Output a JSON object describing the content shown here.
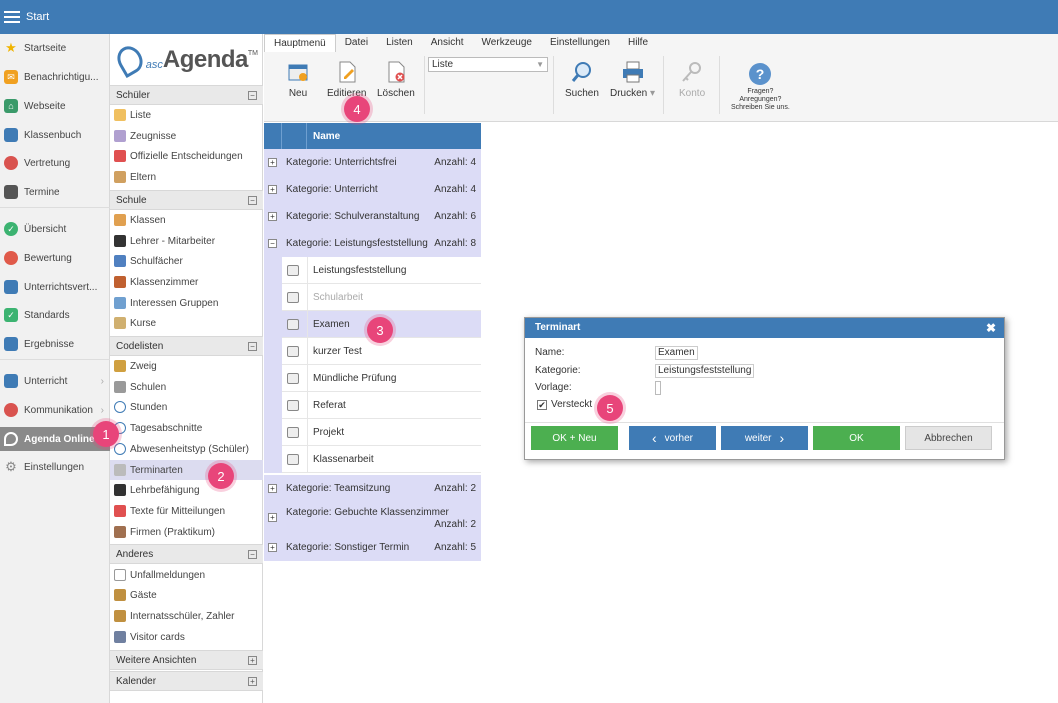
{
  "topbar": {
    "title": "Start"
  },
  "leftnav": {
    "items": [
      {
        "label": "Startseite",
        "icon": "star-icon",
        "color": "#f0b400"
      },
      {
        "label": "Benachrichtigu...",
        "icon": "envelope-icon",
        "color": "#f0a020"
      },
      {
        "label": "Webseite",
        "icon": "home-icon",
        "color": "#3a9a6a"
      },
      {
        "label": "Klassenbuch",
        "icon": "book-icon",
        "color": "#3f7bb5"
      },
      {
        "label": "Vertretung",
        "icon": "person-icon",
        "color": "#d9534f"
      },
      {
        "label": "Termine",
        "icon": "calendar-icon",
        "color": "#555555"
      },
      {
        "label": "Übersicht",
        "icon": "check-circle-icon",
        "color": "#3cb371"
      },
      {
        "label": "Bewertung",
        "icon": "chart-circle-icon",
        "color": "#e05a4a"
      },
      {
        "label": "Unterrichtsvert...",
        "icon": "table-icon",
        "color": "#3f7bb5"
      },
      {
        "label": "Standards",
        "icon": "shield-check-icon",
        "color": "#3cb371"
      },
      {
        "label": "Ergebnisse",
        "icon": "bar-chart-icon",
        "color": "#3f7bb5"
      },
      {
        "label": "Unterricht",
        "icon": "monitor-icon",
        "color": "#3f7bb5"
      },
      {
        "label": "Kommunikation",
        "icon": "chat-icon",
        "color": "#d9534f"
      },
      {
        "label": "Agenda Online",
        "icon": "agenda-icon",
        "color": "#ffffff"
      },
      {
        "label": "Einstellungen",
        "icon": "gear-icon",
        "color": "#888888"
      }
    ]
  },
  "logo": {
    "prefix": "asc",
    "name": "Agenda",
    "tm": "TM"
  },
  "sections": {
    "schueler": {
      "title": "Schüler",
      "items": [
        "Liste",
        "Zeugnisse",
        "Offizielle Entscheidungen",
        "Eltern"
      ]
    },
    "schule": {
      "title": "Schule",
      "items": [
        "Klassen",
        "Lehrer - Mitarbeiter",
        "Schulfächer",
        "Klassenzimmer",
        "Interessen Gruppen",
        "Kurse"
      ]
    },
    "codelisten": {
      "title": "Codelisten",
      "items": [
        "Zweig",
        "Schulen",
        "Stunden",
        "Tagesabschnitte",
        "Abwesenheitstyp (Schüler)",
        "Terminarten",
        "Lehrbefähigung",
        "Texte für Mitteilungen",
        "Firmen (Praktikum)"
      ]
    },
    "anderes": {
      "title": "Anderes",
      "items": [
        "Unfallmeldungen",
        "Gäste",
        "Internatsschüler, Zahler",
        "Visitor cards"
      ]
    },
    "weitere": {
      "title": "Weitere Ansichten"
    },
    "kalender": {
      "title": "Kalender"
    }
  },
  "toolbar": {
    "tabs": [
      "Hauptmenü",
      "Datei",
      "Listen",
      "Ansicht",
      "Werkzeuge",
      "Einstellungen",
      "Hilfe"
    ],
    "neu": "Neu",
    "editieren": "Editieren",
    "loeschen": "Löschen",
    "select_value": "Liste",
    "suchen": "Suchen",
    "drucken": "Drucken",
    "konto": "Konto",
    "help_line1": "Fragen?",
    "help_line2": "Anregungen?",
    "help_line3": "Schreiben Sie uns."
  },
  "list": {
    "header": "Name",
    "count_prefix": "Anzahl:",
    "categories": [
      {
        "label": "Kategorie: Unterrichtsfrei",
        "count": "4",
        "expanded": false
      },
      {
        "label": "Kategorie: Unterricht",
        "count": "4",
        "expanded": false
      },
      {
        "label": "Kategorie: Schulveranstaltung",
        "count": "6",
        "expanded": false
      },
      {
        "label": "Kategorie: Leistungsfeststellung",
        "count": "8",
        "expanded": true
      },
      {
        "label": "Kategorie: Teamsitzung",
        "count": "2",
        "expanded": false
      },
      {
        "label": "Kategorie: Gebuchte Klassenzimmer",
        "count": "2",
        "expanded": false
      },
      {
        "label": "Kategorie: Sonstiger Termin",
        "count": "5",
        "expanded": false
      }
    ],
    "subitems": [
      "Leistungsfeststellung",
      "Schularbeit",
      "Examen",
      "kurzer Test",
      "Mündliche Prüfung",
      "Referat",
      "Projekt",
      "Klassenarbeit"
    ]
  },
  "dialog": {
    "title": "Terminart",
    "name_label": "Name:",
    "name_value": "Examen",
    "kategorie_label": "Kategorie:",
    "kategorie_value": "Leistungsfeststellung",
    "vorlage_label": "Vorlage:",
    "versteckt_label": "Versteckt",
    "versteckt_checked": true,
    "btn_ok_neu": "OK + Neu",
    "btn_vorher": "vorher",
    "btn_weiter": "weiter",
    "btn_ok": "OK",
    "btn_abbrechen": "Abbrechen"
  },
  "badges": [
    "1",
    "2",
    "3",
    "4",
    "5"
  ],
  "colors": {
    "primary": "#3f7bb5",
    "green": "#4caf50",
    "badge": "#e8457a",
    "category_bg": "#dcdcf6"
  }
}
